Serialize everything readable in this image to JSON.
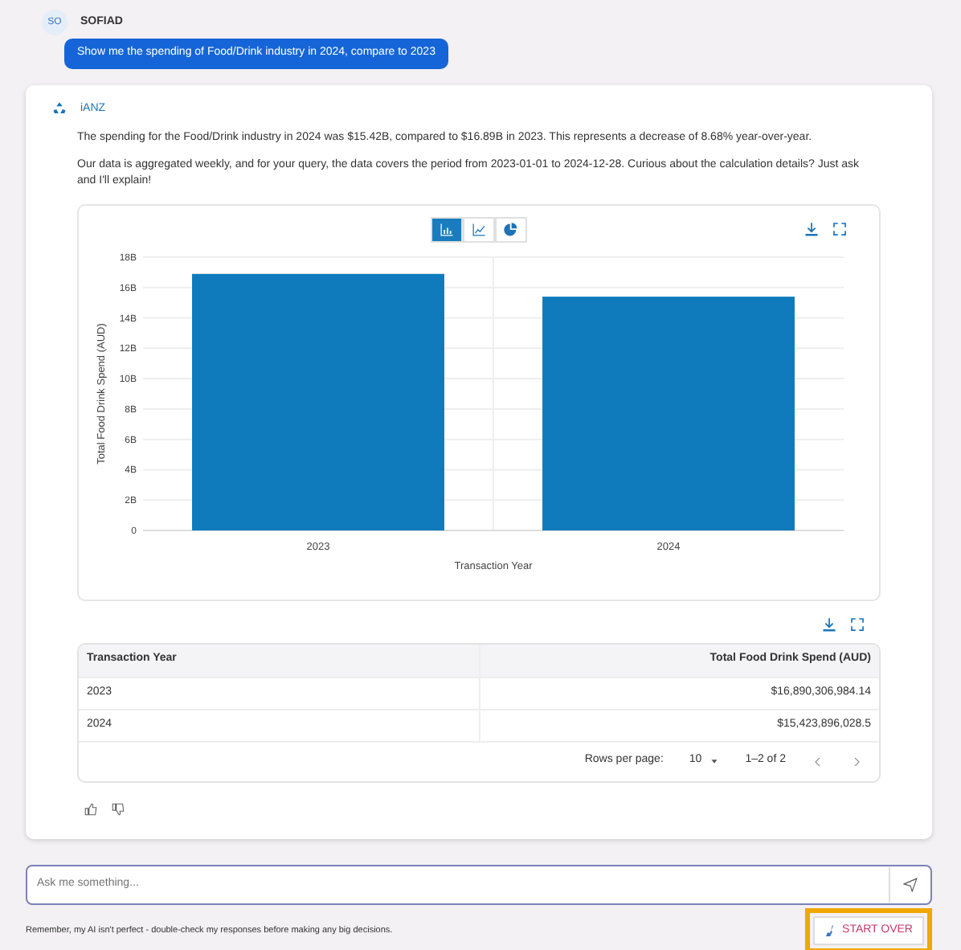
{
  "user_message": {
    "avatar": "SO",
    "name": "SOFIAD",
    "text": "Show me the spending of Food/Drink industry in 2024, compare to 2023"
  },
  "assistant": {
    "name": "iANZ",
    "paragraphs": [
      "The spending for the Food/Drink industry in 2024 was $15.42B, compared to $16.89B in 2023. This represents a decrease of 8.68% year-over-year.",
      "Our data is aggregated weekly, and for your query, the data covers the period from 2023-01-01 to 2024-12-28. Curious about the calculation details? Just ask and I'll explain!"
    ]
  },
  "chart_views": [
    {
      "kind": "bar",
      "selected": true
    },
    {
      "kind": "line",
      "selected": false
    },
    {
      "kind": "pie",
      "selected": false
    }
  ],
  "chart_data": {
    "type": "bar",
    "xlabel": "Transaction Year",
    "ylabel": "Total Food Drink Spend (AUD)",
    "categories": [
      "2023",
      "2024"
    ],
    "series": [
      {
        "color": "#0f7bbd",
        "values": [
          16.9,
          15.4
        ]
      }
    ],
    "grid": true,
    "ylim": [
      0,
      18
    ],
    "yticks": [
      {
        "value": 0,
        "label": "0"
      },
      {
        "value": 2,
        "label": "2B"
      },
      {
        "value": 4,
        "label": "4B"
      },
      {
        "value": 6,
        "label": "6B"
      },
      {
        "value": 8,
        "label": "8B"
      },
      {
        "value": 10,
        "label": "10B"
      },
      {
        "value": 12,
        "label": "12B"
      },
      {
        "value": 14,
        "label": "14B"
      },
      {
        "value": 16,
        "label": "16B"
      },
      {
        "value": 18,
        "label": "18B"
      }
    ]
  },
  "table": {
    "columns": [
      "Transaction Year",
      "Total Food Drink Spend (AUD)"
    ],
    "rows": [
      [
        "2023",
        "$16,890,306,984.14"
      ],
      [
        "2024",
        "$15,423,896,028.5"
      ]
    ],
    "rows_per_page_label": "Rows per page:",
    "rows_per_page": "10",
    "range": "1–2 of 2"
  },
  "input": {
    "placeholder": "Ask me something..."
  },
  "disclaimer": "Remember, my AI isn't perfect - double-check my responses before making any big decisions.",
  "start_over": {
    "label": "START OVER",
    "highlighted": true
  }
}
